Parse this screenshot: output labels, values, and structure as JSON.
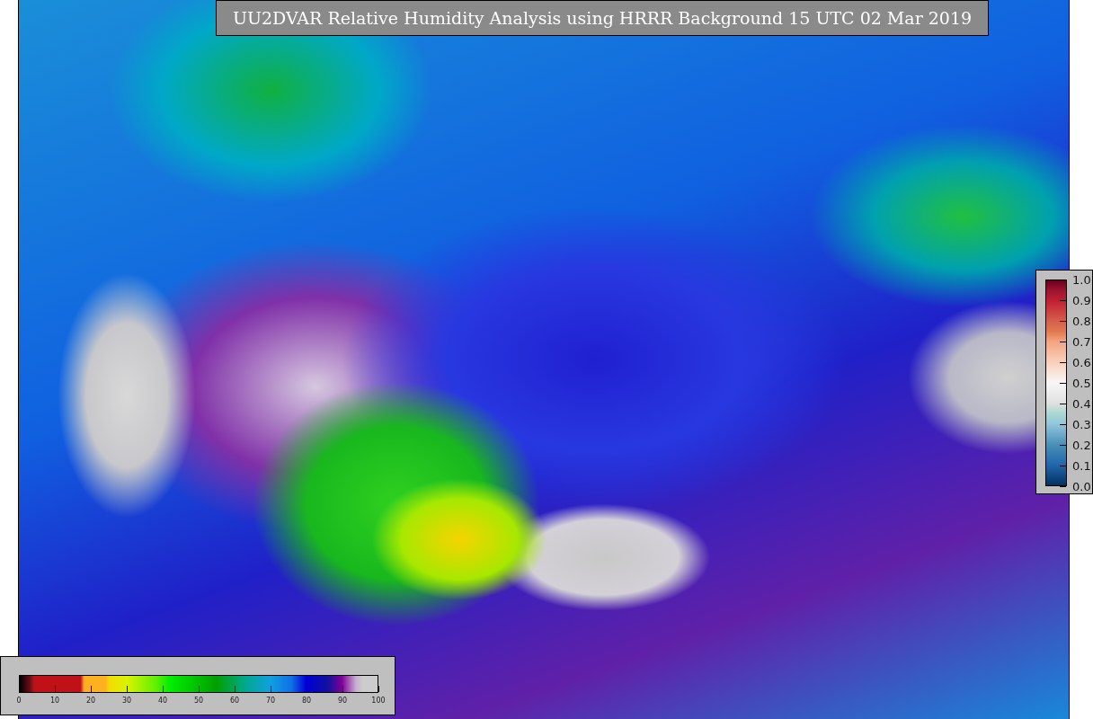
{
  "title": "UU2DVAR Relative Humidity Analysis using HRRR Background 15 UTC 02 Mar 2019",
  "humidity_colorbar": {
    "ticks": [
      "0",
      "10",
      "20",
      "30",
      "40",
      "50",
      "60",
      "70",
      "80",
      "90",
      "100"
    ]
  },
  "station_colorbar": {
    "ticks": [
      "1.0",
      "0.9",
      "0.8",
      "0.7",
      "0.6",
      "0.5",
      "0.4",
      "0.3",
      "0.2",
      "0.1",
      "0.0"
    ]
  }
}
